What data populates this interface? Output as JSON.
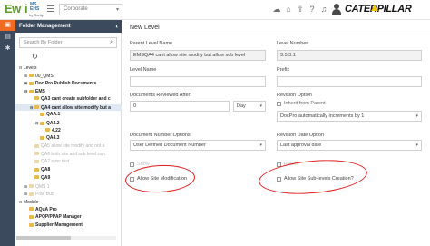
{
  "header": {
    "logo_main": "Ew",
    "logo_i": "i",
    "logo_sup": "MS\nEHS",
    "logo_sub": "by Cority",
    "company_select": "Corporate",
    "brand": "CATERPILLAR",
    "tool_icons": [
      "cloud-upload-icon",
      "home-icon",
      "share-icon",
      "help-icon",
      "bell-icon",
      "user-icon"
    ]
  },
  "rail": {
    "items": [
      "folder-icon",
      "document-icon",
      "gear-icon"
    ]
  },
  "folder_panel": {
    "title": "Folder Management",
    "search_placeholder": "Search By Folder",
    "tree": [
      {
        "label": "Levels",
        "toggle": "⊟",
        "style": "normal"
      },
      {
        "label": "00_QMS",
        "toggle": "⊞",
        "style": "normal"
      },
      {
        "label": "Doc Pro Publish Documents",
        "toggle": "⊞",
        "style": "bold"
      },
      {
        "label": "EMS",
        "toggle": "⊟",
        "style": "bold"
      },
      {
        "label": "QA3 cant create subfolder and c",
        "toggle": "",
        "style": "bold"
      },
      {
        "label": "QA4 cant allow site modify but a",
        "toggle": "⊟",
        "style": "bold selected"
      },
      {
        "label": "QAA.1",
        "toggle": "",
        "style": "bold"
      },
      {
        "label": "QA4.2",
        "toggle": "⊟",
        "style": "bold"
      },
      {
        "label": "4.22",
        "toggle": "",
        "style": "bold"
      },
      {
        "label": "QA4.3",
        "toggle": "",
        "style": "bold"
      },
      {
        "label": "QA5 allow site modify and not a",
        "toggle": "",
        "style": "faded"
      },
      {
        "label": "QA6 both site and sub level can",
        "toggle": "",
        "style": "faded"
      },
      {
        "label": "QA7 sync test",
        "toggle": "",
        "style": "faded"
      },
      {
        "label": "QA8",
        "toggle": "",
        "style": "bold"
      },
      {
        "label": "QA9",
        "toggle": "",
        "style": "bold"
      },
      {
        "label": "QMS 1",
        "toggle": "⊞",
        "style": "faded"
      },
      {
        "label": "Prac Buc",
        "toggle": "⊞",
        "style": "faded"
      },
      {
        "label": "Module",
        "toggle": "⊟",
        "style": "normal"
      },
      {
        "label": "AQuA Pro",
        "toggle": "",
        "style": "bold"
      },
      {
        "label": "APQP/PPAP Manager",
        "toggle": "",
        "style": "bold"
      },
      {
        "label": "Supplier Management",
        "toggle": "",
        "style": "bold"
      }
    ]
  },
  "form": {
    "title": "New Level",
    "parent_level_name": {
      "label": "Parent Level Name",
      "value": "EMSQA4 cant allow site modify but allow sub level"
    },
    "level_number": {
      "label": "Level Number",
      "value": "3.5.3.1"
    },
    "level_name": {
      "label": "Level Name",
      "value": ""
    },
    "prefix": {
      "label": "Prefix",
      "value": ""
    },
    "documents_reviewed_after": {
      "label": "Documents Reviewed After:",
      "value": "0",
      "unit": "Day"
    },
    "revision_option": {
      "label": "Revision Option",
      "inherit_label": "Inherit from Parent",
      "value": "DocPro automatically increments by 1"
    },
    "document_number_options": {
      "label": "Document Number Options",
      "value": "User Defined Document Number"
    },
    "revision_date_option": {
      "label": "Revision Date Option",
      "value": "Last approval date"
    },
    "allow_site_modification": {
      "ghost": "Show",
      "label": "Allow Site Modification"
    },
    "allow_site_sub_levels": {
      "ghost": "Return",
      "label": "Allow Site Sub-levels Creation?"
    }
  },
  "colors": {
    "rail_bg": "#3c4a5e",
    "active_tab": "#f06a22",
    "annotation": "#e01d1d",
    "cat_yellow": "#f5c300"
  }
}
